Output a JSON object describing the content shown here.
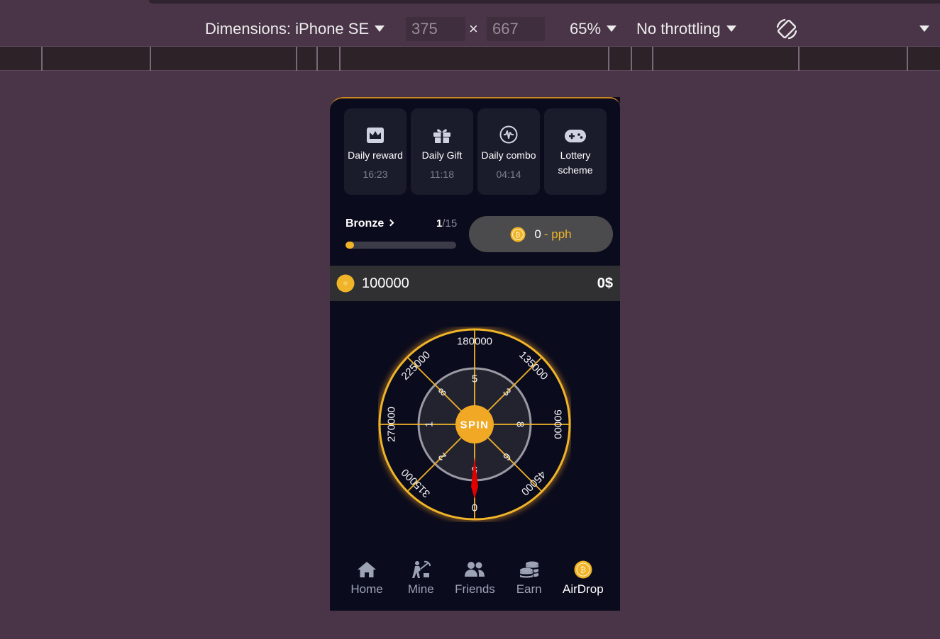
{
  "devtools": {
    "dimensions_label": "Dimensions: iPhone SE",
    "width_value": "375",
    "times_glyph": "×",
    "height_value": "667",
    "zoom": "65%",
    "throttling": "No throttling"
  },
  "app": {
    "daily_cards": [
      {
        "icon": "crown-icon",
        "label": "Daily reward",
        "time": "16:23"
      },
      {
        "icon": "gift-icon",
        "label": "Daily Gift",
        "time": "11:18"
      },
      {
        "icon": "combo-icon",
        "label": "Daily combo",
        "time": "04:14"
      },
      {
        "icon": "gamepad-icon",
        "label": "Lottery scheme",
        "time": ""
      }
    ],
    "level": {
      "name": "Bronze",
      "current": "1",
      "total": "/15",
      "progress_fraction": 0.02
    },
    "pph": {
      "value": "0",
      "suffix": "- pph"
    },
    "balance": {
      "coins": "100000",
      "usd": "0$"
    },
    "wheel": {
      "outer_values": [
        "180000",
        "135000",
        "90000",
        "45000",
        "0",
        "315000",
        "270000",
        "225000"
      ],
      "inner_values": [
        "5",
        "3",
        "8",
        "6",
        "5",
        "2",
        "1",
        "8"
      ],
      "spin_label": "SPIN"
    },
    "nav": [
      {
        "icon": "home-icon",
        "label": "Home",
        "active": false
      },
      {
        "icon": "mine-icon",
        "label": "Mine",
        "active": false
      },
      {
        "icon": "friends-icon",
        "label": "Friends",
        "active": false
      },
      {
        "icon": "earn-icon",
        "label": "Earn",
        "active": false
      },
      {
        "icon": "airdrop-coin-icon",
        "label": "AirDrop",
        "active": true
      }
    ],
    "colors": {
      "accent": "#f0b428",
      "background": "#0b0b1e",
      "pointer": "#e00000"
    }
  }
}
